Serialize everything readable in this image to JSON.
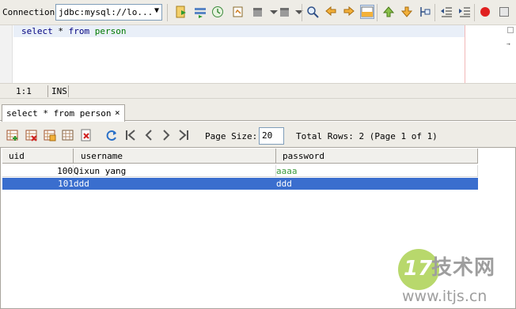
{
  "toolbar": {
    "connection_label": "Connection:",
    "connection_value": "jdbc:mysql://lo...",
    "icons": [
      "run-script-icon",
      "run-statement-icon",
      "history-icon",
      "explain-icon",
      "bookmark-icon",
      "bookmark-dropdown-icon",
      "find-icon",
      "undo-icon",
      "redo-icon",
      "result-pane-icon",
      "move-up-icon",
      "move-down-icon",
      "format-icon",
      "unindent-icon",
      "indent-icon",
      "stop-icon",
      "close-icon"
    ],
    "colors": {
      "stop": "#ff0000",
      "background": "#eeece6"
    }
  },
  "editor": {
    "query_tokens": [
      {
        "text": "select",
        "kind": "keyword"
      },
      {
        "text": "*",
        "kind": "plain"
      },
      {
        "text": "from",
        "kind": "keyword"
      },
      {
        "text": "person",
        "kind": "identifier"
      }
    ],
    "colors": {
      "keyword": "#000080",
      "identifier": "#007a00"
    }
  },
  "status": {
    "position": "1:1",
    "mode": "INS"
  },
  "result_tab": {
    "label": "select * from person",
    "close": "×"
  },
  "result_toolbar": {
    "icons": [
      "insert-row-icon",
      "delete-row-icon",
      "commit-icon",
      "table-icon",
      "cancel-edit-icon",
      "refresh-icon",
      "first-page-icon",
      "previous-page-icon",
      "next-page-icon",
      "last-page-icon"
    ],
    "page_size_label": "Page Size:",
    "page_size_value": "20",
    "total_rows_text": "Total Rows: 2 (Page 1 of 1)"
  },
  "grid": {
    "columns": [
      "uid",
      "username",
      "password"
    ],
    "rows": [
      {
        "uid": "100",
        "username": "Qixun yang",
        "password": "aaaa",
        "selected": false
      },
      {
        "uid": "101",
        "username": "ddd",
        "password": "ddd",
        "selected": true
      }
    ],
    "colors": {
      "selection": "#3a6ece",
      "password_text": "#3c9b3c"
    }
  },
  "watermark": {
    "logo": "17",
    "brand": "技术网",
    "url": "www.itjs.cn"
  }
}
